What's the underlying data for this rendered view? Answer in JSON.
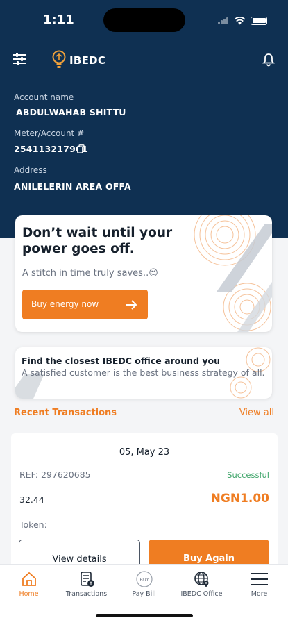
{
  "status_bar": {
    "time": "1:11"
  },
  "header": {
    "app_title": "IBEDC",
    "account_name_label": "Account name",
    "account_name": "ABDULWAHAB SHITTU",
    "meter_label": "Meter/Account #",
    "meter_number": "254113217901",
    "address_label": "Address",
    "address": "ANILELERIN AREA  OFFA"
  },
  "promo": {
    "title": "Don’t wait until your power goes off.",
    "subtitle": "A stitch in time truly saves..😉",
    "button_label": "Buy energy now"
  },
  "office_card": {
    "title": "Find the closest IBEDC office around you",
    "subtitle": "A satisfied customer is the best business strategy of all."
  },
  "recent": {
    "title": "Recent Transactions",
    "view_all": "View all"
  },
  "transaction": {
    "date": "05, May 23",
    "ref": "REF: 297620685",
    "status": "Successful",
    "units": "32.44",
    "amount": "NGN1.00",
    "token_label": "Token:",
    "details_button": "View details",
    "again_button": "Buy Again"
  },
  "tabbar": {
    "items": [
      {
        "label": "Home",
        "icon": "home-icon",
        "active": true
      },
      {
        "label": "Transactions",
        "icon": "transactions-icon",
        "active": false
      },
      {
        "label": "Pay Bill",
        "icon": "pay-bill-icon",
        "active": false
      },
      {
        "label": "IBEDC Office",
        "icon": "office-globe-icon",
        "active": false
      },
      {
        "label": "More",
        "icon": "menu-icon",
        "active": false
      }
    ]
  },
  "colors": {
    "brand_navy": "#0f3052",
    "accent_orange": "#ef7d22",
    "success_green": "#3fa56a"
  }
}
